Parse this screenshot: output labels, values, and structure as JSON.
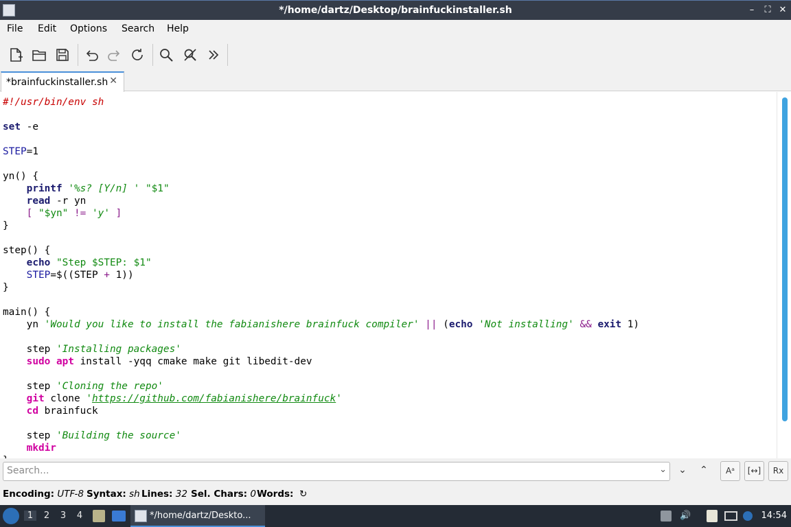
{
  "window": {
    "title": "*/home/dartz/Desktop/brainfuckinstaller.sh",
    "controls": {
      "minimize": "–",
      "maximize": "⛶",
      "close": "✕"
    }
  },
  "menu": [
    "File",
    "Edit",
    "Options",
    "Search",
    "Help"
  ],
  "toolbar": {
    "icons": [
      "new-file-icon",
      "open-file-icon",
      "save-icon",
      "undo-icon",
      "redo-icon",
      "reload-icon",
      "find-icon",
      "replace-icon",
      "more-icon"
    ]
  },
  "tab": {
    "label": "*brainfuckinstaller.sh",
    "close": "✕"
  },
  "editor": {
    "lines": [
      [
        {
          "t": "#!/usr/bin/env sh",
          "c": "com"
        }
      ],
      [],
      [
        {
          "t": "set",
          "c": "kw"
        },
        {
          "t": " -e"
        }
      ],
      [],
      [
        {
          "t": "STEP",
          "c": "var"
        },
        {
          "t": "=1"
        }
      ],
      [],
      [
        {
          "t": "yn() {"
        }
      ],
      [
        {
          "t": "    "
        },
        {
          "t": "printf",
          "c": "kw"
        },
        {
          "t": " "
        },
        {
          "t": "'%s? [Y/n] '",
          "c": "sq"
        },
        {
          "t": " "
        },
        {
          "t": "\"$1\"",
          "c": "str"
        }
      ],
      [
        {
          "t": "    "
        },
        {
          "t": "read",
          "c": "kw"
        },
        {
          "t": " -r yn"
        }
      ],
      [
        {
          "t": "    "
        },
        {
          "t": "[",
          "c": "op"
        },
        {
          "t": " "
        },
        {
          "t": "\"$yn\"",
          "c": "str"
        },
        {
          "t": " "
        },
        {
          "t": "!=",
          "c": "op"
        },
        {
          "t": " "
        },
        {
          "t": "'y'",
          "c": "sq"
        },
        {
          "t": " "
        },
        {
          "t": "]",
          "c": "op"
        }
      ],
      [
        {
          "t": "}"
        }
      ],
      [],
      [
        {
          "t": "step() {"
        }
      ],
      [
        {
          "t": "    "
        },
        {
          "t": "echo",
          "c": "kw"
        },
        {
          "t": " "
        },
        {
          "t": "\"Step $STEP: $1\"",
          "c": "str"
        }
      ],
      [
        {
          "t": "    "
        },
        {
          "t": "STEP",
          "c": "var"
        },
        {
          "t": "=$((STEP "
        },
        {
          "t": "+",
          "c": "op"
        },
        {
          "t": " 1))"
        }
      ],
      [
        {
          "t": "}"
        }
      ],
      [],
      [
        {
          "t": "main() {"
        }
      ],
      [
        {
          "t": "    yn "
        },
        {
          "t": "'Would you like to install the fabianishere brainfuck compiler'",
          "c": "sq"
        },
        {
          "t": " "
        },
        {
          "t": "||",
          "c": "op"
        },
        {
          "t": " ("
        },
        {
          "t": "echo",
          "c": "kw"
        },
        {
          "t": " "
        },
        {
          "t": "'Not installing'",
          "c": "sq"
        },
        {
          "t": " "
        },
        {
          "t": "&&",
          "c": "op"
        },
        {
          "t": " "
        },
        {
          "t": "exit",
          "c": "kw"
        },
        {
          "t": " 1)"
        }
      ],
      [],
      [
        {
          "t": "    step "
        },
        {
          "t": "'Installing packages'",
          "c": "sq"
        }
      ],
      [
        {
          "t": "    "
        },
        {
          "t": "sudo",
          "c": "cmd"
        },
        {
          "t": " "
        },
        {
          "t": "apt",
          "c": "cmd"
        },
        {
          "t": " install -yqq cmake make git libedit-dev"
        }
      ],
      [],
      [
        {
          "t": "    step "
        },
        {
          "t": "'Cloning the repo'",
          "c": "sq"
        }
      ],
      [
        {
          "t": "    "
        },
        {
          "t": "git",
          "c": "cmd"
        },
        {
          "t": " clone "
        },
        {
          "t": "'",
          "c": "sq"
        },
        {
          "t": "https://github.com/fabianishere/brainfuck",
          "c": "sq url"
        },
        {
          "t": "'",
          "c": "sq"
        }
      ],
      [
        {
          "t": "    "
        },
        {
          "t": "cd",
          "c": "cmd"
        },
        {
          "t": " brainfuck"
        }
      ],
      [],
      [
        {
          "t": "    step "
        },
        {
          "t": "'Building the source'",
          "c": "sq"
        }
      ],
      [
        {
          "t": "    "
        },
        {
          "t": "mkdir",
          "c": "cmd"
        }
      ],
      [
        {
          "t": "}"
        }
      ]
    ]
  },
  "search": {
    "placeholder": "Search...",
    "down": "⌄",
    "next": "⌄",
    "prev": "⌃",
    "case": "Aᵃ",
    "whole": "[↔]",
    "regex": "Rx"
  },
  "status": {
    "encoding_label": "Encoding:",
    "encoding": "UTF-8",
    "syntax_label": "Syntax:",
    "syntax": "sh",
    "lines_label": "Lines:",
    "lines": "32",
    "sel_label": "Sel. Chars:",
    "sel": "0",
    "words_label": "Words:",
    "refresh": "↻"
  },
  "taskbar": {
    "workspaces": [
      "1",
      "2",
      "3",
      "4"
    ],
    "task_title": "*/home/dartz/Deskto...",
    "clock": "14:54"
  }
}
